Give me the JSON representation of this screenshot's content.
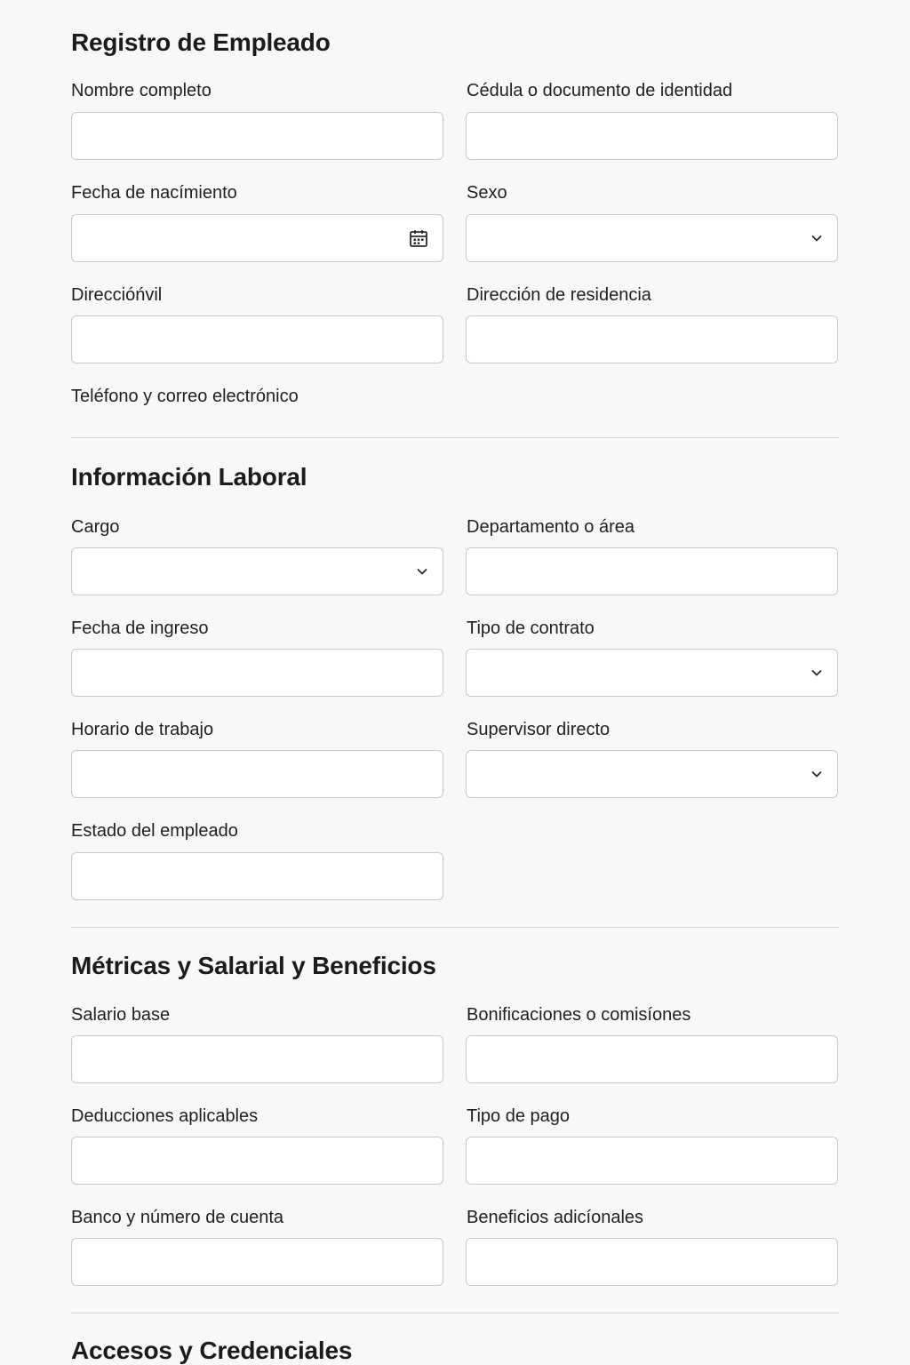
{
  "sections": {
    "registro": {
      "title": "Registro de Empleado",
      "nombre_label": "Nombre completo",
      "cedula_label": "Cédula o documento de identidad",
      "fecha_nacimiento_label": "Fecha de nacímiento",
      "sexo_label": "Sexo",
      "direccion_civil_label": "Direccióńvil",
      "direccion_residencia_label": "Dirección de residencia",
      "telefono_correo_label": "Teléfono y correo electrónico"
    },
    "laboral": {
      "title": "Información Laboral",
      "cargo_label": "Cargo",
      "departamento_label": "Departamento o área",
      "fecha_ingreso_label": "Fecha de ingreso",
      "tipo_contrato_label": "Tipo de contrato",
      "horario_label": "Horario de trabajo",
      "supervisor_label": "Supervisor directo",
      "estado_label": "Estado del empleado"
    },
    "salarial": {
      "title": "Métricas y Salarial y Beneficios",
      "salario_label": "Salario base",
      "bonificaciones_label": "Bonificaciones o comisíones",
      "deducciones_label": "Deducciones aplicables",
      "tipo_pago_label": "Tipo de pago",
      "banco_label": "Banco y número de cuenta",
      "beneficios_label": "Beneficios adicíonales"
    },
    "accesos": {
      "title": "Accesos y Credenciales"
    }
  },
  "icons": {
    "calendar": "calendar-icon",
    "dropdown": "chevron-down-icon"
  },
  "colors": {
    "background": "#f9f8f8",
    "field_background": "#ffffff",
    "field_border": "#c9c9cc",
    "divider": "#d3d3d6",
    "text": "#1b1b1d"
  }
}
